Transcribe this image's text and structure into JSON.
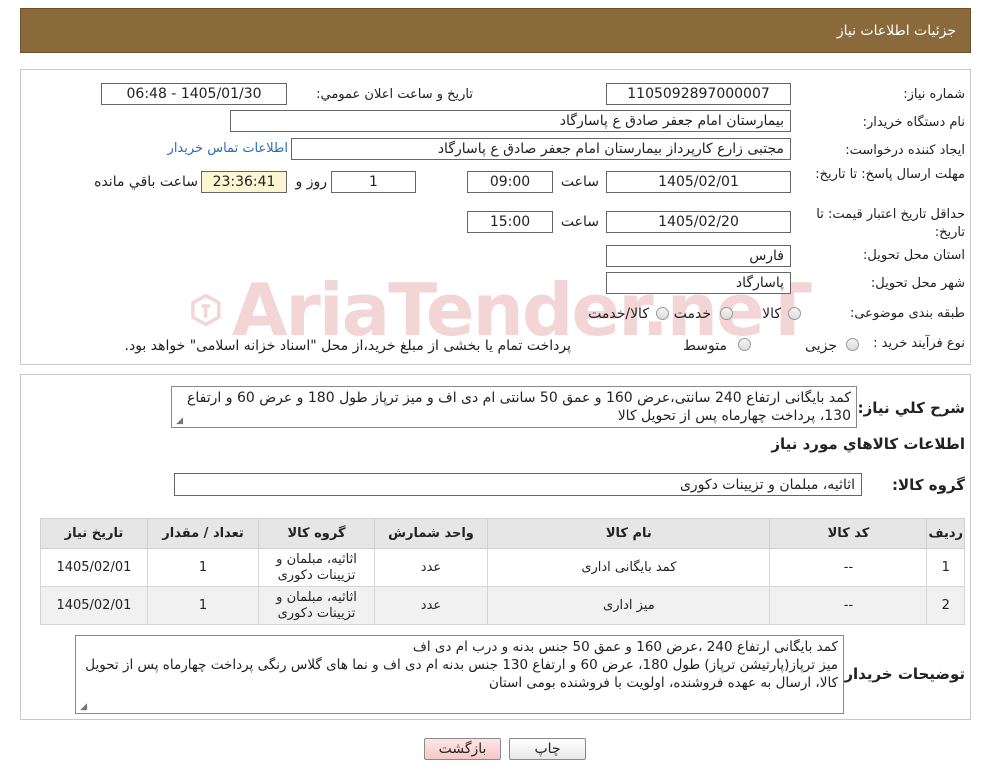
{
  "header": {
    "title": "جزئيات اطلاعات نياز"
  },
  "form": {
    "need_number_label": "شماره نیاز:",
    "need_number": "1105092897000007",
    "announce_label": "تاريخ و ساعت اعلان عمومي:",
    "announce_value": "1405/01/30 - 06:48",
    "buyer_org_label": "نام دستگاه خریدار:",
    "buyer_org": "بیمارستان امام جعفر صادق ع  پاسارگاد",
    "creator_label": "ایجاد کننده درخواست:",
    "creator": "مجتبی زارع کارپرداز بیمارستان امام جعفر صادق ع  پاسارگاد",
    "contact_link": "اطلاعات تماس خریدار",
    "reply_deadline_label": "مهلت ارسال پاسخ: تا تاریخ:",
    "reply_date": "1405/02/01",
    "time_word": "ساعت",
    "reply_time": "09:00",
    "days_value": "1",
    "days_word": "روز و",
    "remaining_time": "23:36:41",
    "remaining_word": "ساعت باقي مانده",
    "validity_label": "حداقل تاریخ اعتبار قیمت: تا تاریخ:",
    "validity_date": "1405/02/20",
    "validity_time": "15:00",
    "province_label": "استان محل تحویل:",
    "province": "فارس",
    "city_label": "شهر محل تحویل:",
    "city": "پاسارگاد",
    "category_label": "طبقه بندی موضوعی:",
    "category_options": [
      "کالا",
      "خدمت",
      "کالا/خدمت"
    ],
    "process_label": "نوع فرآیند خرید :",
    "process_options": [
      "جزیی",
      "متوسط"
    ],
    "process_note": "پرداخت تمام یا بخشی از مبلغ خرید،از محل \"اسناد خزانه اسلامی\" خواهد بود."
  },
  "summary": {
    "label": "شرح کلي نياز:",
    "text": "کمد بایگانی ارتفاع 240 سانتی،عرض 160 و عمق 50 سانتی ام دی اف و میز ترپاز طول 180 و عرض 60 و ارتفاع 130، پرداخت چهارماه پس از تحویل کالا"
  },
  "goods": {
    "section_title": "اطلاعات کالاهاي مورد نياز",
    "group_label": "گروه کالا:",
    "group_value": "اثاثیه، مبلمان و تزیینات دکوری",
    "columns": [
      "رديف",
      "کد کالا",
      "نام کالا",
      "واحد شمارش",
      "گروه کالا",
      "تعداد / مقدار",
      "تاريخ نياز"
    ],
    "rows": [
      [
        "1",
        "--",
        "کمد بایگانی اداری",
        "عدد",
        "اثاثیه، مبلمان و تزیینات دکوری",
        "1",
        "1405/02/01"
      ],
      [
        "2",
        "--",
        "میز اداری",
        "عدد",
        "اثاثیه، مبلمان و تزیینات دکوری",
        "1",
        "1405/02/01"
      ]
    ]
  },
  "buyer_notes": {
    "label": "توضیحات خریدار:",
    "lines": [
      "کمد بایگانی ارتفاع 240 ،عرض 160 و عمق 50  جنس بدنه و درب ام دی اف",
      "میز ترپاز(پارتیشن ترپاز) طول 180، عرض 60 و ارتفاع 130 جنس بدنه ام دی اف و نما های گلاس رنگی پرداخت چهارماه پس از تحویل کالا، ارسال به عهده فروشنده، اولویت با فروشنده بومی استان"
    ]
  },
  "buttons": {
    "print": "چاپ",
    "back": "بازگشت"
  },
  "watermark": {
    "text": "AriaTender.neT"
  }
}
